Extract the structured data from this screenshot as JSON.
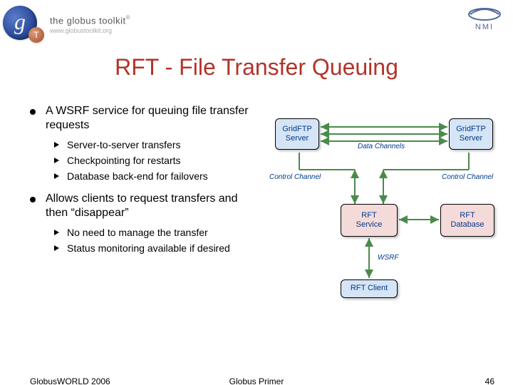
{
  "header": {
    "logo_text": "the globus toolkit",
    "logo_reg": "®",
    "logo_sub": "www.globustoolkit.org",
    "nmi": "NMI"
  },
  "title": "RFT - File Transfer Queuing",
  "bullets": [
    {
      "text": "A WSRF service for queuing file transfer requests",
      "sub": [
        "Server-to-server transfers",
        "Checkpointing for restarts",
        "Database back-end for failovers"
      ]
    },
    {
      "text": "Allows clients to request transfers and then “disappear”",
      "sub": [
        "No need to manage the transfer",
        "Status monitoring available if desired"
      ]
    }
  ],
  "diagram": {
    "gridftp1": "GridFTP\nServer",
    "gridftp2": "GridFTP\nServer",
    "data_channels": "Data Channels",
    "control_channel": "Control Channel",
    "rft_service": "RFT\nService",
    "rft_database": "RFT\nDatabase",
    "wsrf": "WSRF",
    "rft_client": "RFT Client"
  },
  "footer": {
    "left": "GlobusWORLD 2006",
    "center": "Globus Primer",
    "right": "46"
  }
}
